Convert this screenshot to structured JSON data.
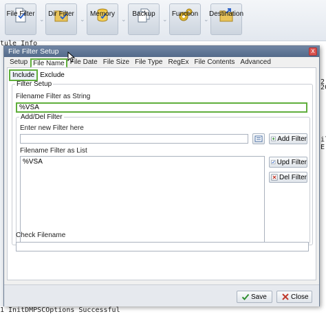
{
  "toolbar": {
    "buttons": [
      {
        "label": "File Filter",
        "icon": "file-filter-icon"
      },
      {
        "label": "Dir Filter",
        "icon": "folder-filter-icon"
      },
      {
        "label": "Memory",
        "icon": "memory-icon"
      },
      {
        "label": "Backup",
        "icon": "backup-icon"
      },
      {
        "label": "Function",
        "icon": "gear-icon"
      },
      {
        "label": "Destination",
        "icon": "destination-icon"
      }
    ],
    "separator": "⌄"
  },
  "background": {
    "module_info": "tule Info",
    "right_glyphs": [
      "2",
      "2C",
      "il",
      "E"
    ],
    "bottom_text": "1 InitDMPSCOptions Successful"
  },
  "dialog": {
    "title": "File Filter Setup",
    "close_glyph": "x",
    "tabs": [
      "Setup",
      "File Name",
      "File Date",
      "File Size",
      "File Type",
      "RegEx",
      "File Contents",
      "Advanced"
    ],
    "active_tab": "File Name",
    "subtabs": [
      "Include",
      "Exclude"
    ],
    "active_subtab": "Include",
    "filter_setup": {
      "group_label": "Filter Setup",
      "string_label": "Filename Filter as String",
      "string_value": "%VSA"
    },
    "add_del": {
      "group_label": "Add/Del Filter",
      "enter_label": "Enter new Filter here",
      "enter_value": "",
      "list_label": "Filename Filter as List",
      "list_items": [
        "%VSA"
      ],
      "add_button": "Add Filter",
      "upd_button": "Upd Filter",
      "del_button": "Del Filter"
    },
    "check": {
      "label": "Check Filename",
      "value": ""
    },
    "footer": {
      "save_label": "Save",
      "close_label": "Close"
    }
  },
  "colors": {
    "highlight": "#5fae3b",
    "title_bar": "#5b7090"
  }
}
